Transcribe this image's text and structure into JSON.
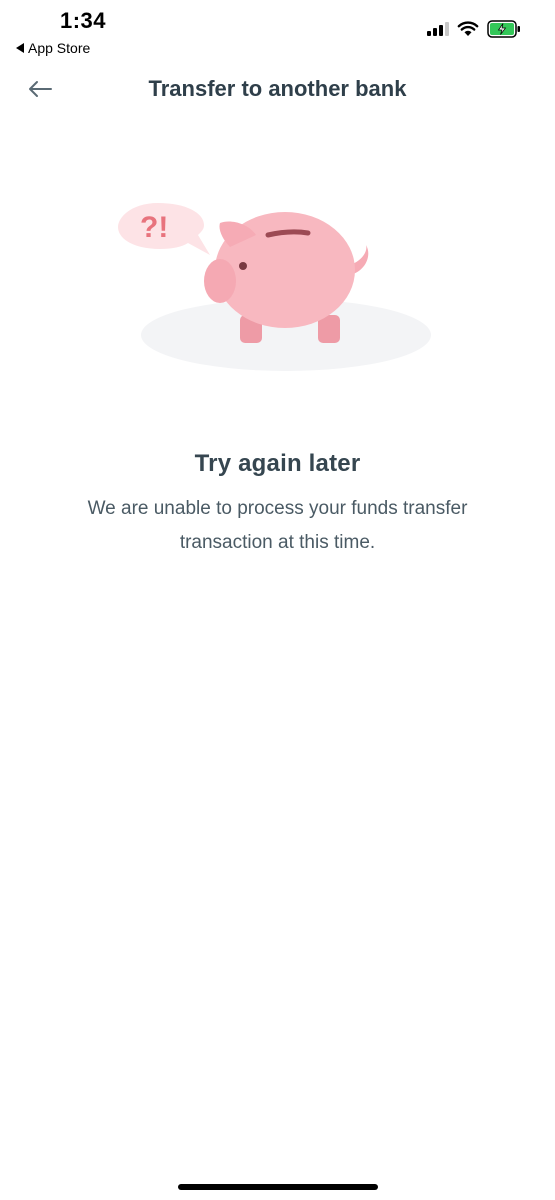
{
  "status_bar": {
    "time": "1:34",
    "back_app_label": "App Store",
    "icons": [
      "cellular-signal-icon",
      "wifi-icon",
      "battery-charging-icon"
    ]
  },
  "header": {
    "title": "Transfer to another bank",
    "back_icon": "arrow-left-icon"
  },
  "illustration": {
    "bubble_text": "?!",
    "subject": "piggy-bank"
  },
  "message": {
    "title": "Try again later",
    "body_line1": "We are unable to process your funds transfer",
    "body_line2": "transaction at this time."
  },
  "colors": {
    "text_primary": "#2f3f4a",
    "pig_pink": "#f8b8c0",
    "bubble_pink": "#fde3e6",
    "bubble_text": "#e8737d",
    "battery_green": "#34c759"
  }
}
